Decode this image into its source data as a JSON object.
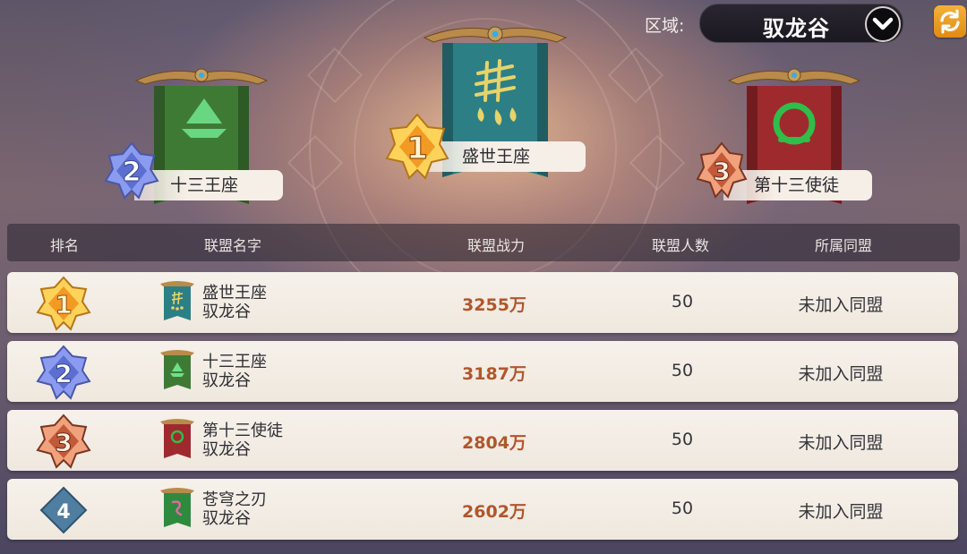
{
  "region": {
    "label": "区域:",
    "value": "驭龙谷"
  },
  "podium": [
    {
      "rank": "2",
      "name": "十三王座",
      "color": "#3f7a35"
    },
    {
      "rank": "1",
      "name": "盛世王座",
      "color": "#2d7f86"
    },
    {
      "rank": "3",
      "name": "第十三使徒",
      "color": "#9e2a2e"
    }
  ],
  "table": {
    "headers": {
      "rank": "排名",
      "name": "联盟名字",
      "power": "联盟战力",
      "members": "联盟人数",
      "alliance": "所属同盟"
    },
    "rows": [
      {
        "rank": "1",
        "name": "盛世王座",
        "region": "驭龙谷",
        "power": "3255万",
        "members": "50",
        "alliance": "未加入同盟",
        "banner_color": "#2d7f86"
      },
      {
        "rank": "2",
        "name": "十三王座",
        "region": "驭龙谷",
        "power": "3187万",
        "members": "50",
        "alliance": "未加入同盟",
        "banner_color": "#3f7a35"
      },
      {
        "rank": "3",
        "name": "第十三使徒",
        "region": "驭龙谷",
        "power": "2804万",
        "members": "50",
        "alliance": "未加入同盟",
        "banner_color": "#9e2a2e"
      },
      {
        "rank": "4",
        "name": "苍穹之刃",
        "region": "驭龙谷",
        "power": "2602万",
        "members": "50",
        "alliance": "未加入同盟",
        "banner_color": "#2f8a3e"
      }
    ]
  },
  "icons": {
    "region_dropdown": "chevron-down-icon",
    "refresh": "refresh-icon",
    "rank_badge": "rank-star-badge-icon",
    "alliance_banner": "alliance-banner-icon"
  },
  "colors": {
    "power_text": "#b1562c",
    "refresh_button": "#f0a02a",
    "gold_badge": "#f2b23a",
    "silver_badge": "#6e7fd8",
    "bronze_badge": "#c9694a",
    "plain_badge": "#4f7ea0"
  }
}
